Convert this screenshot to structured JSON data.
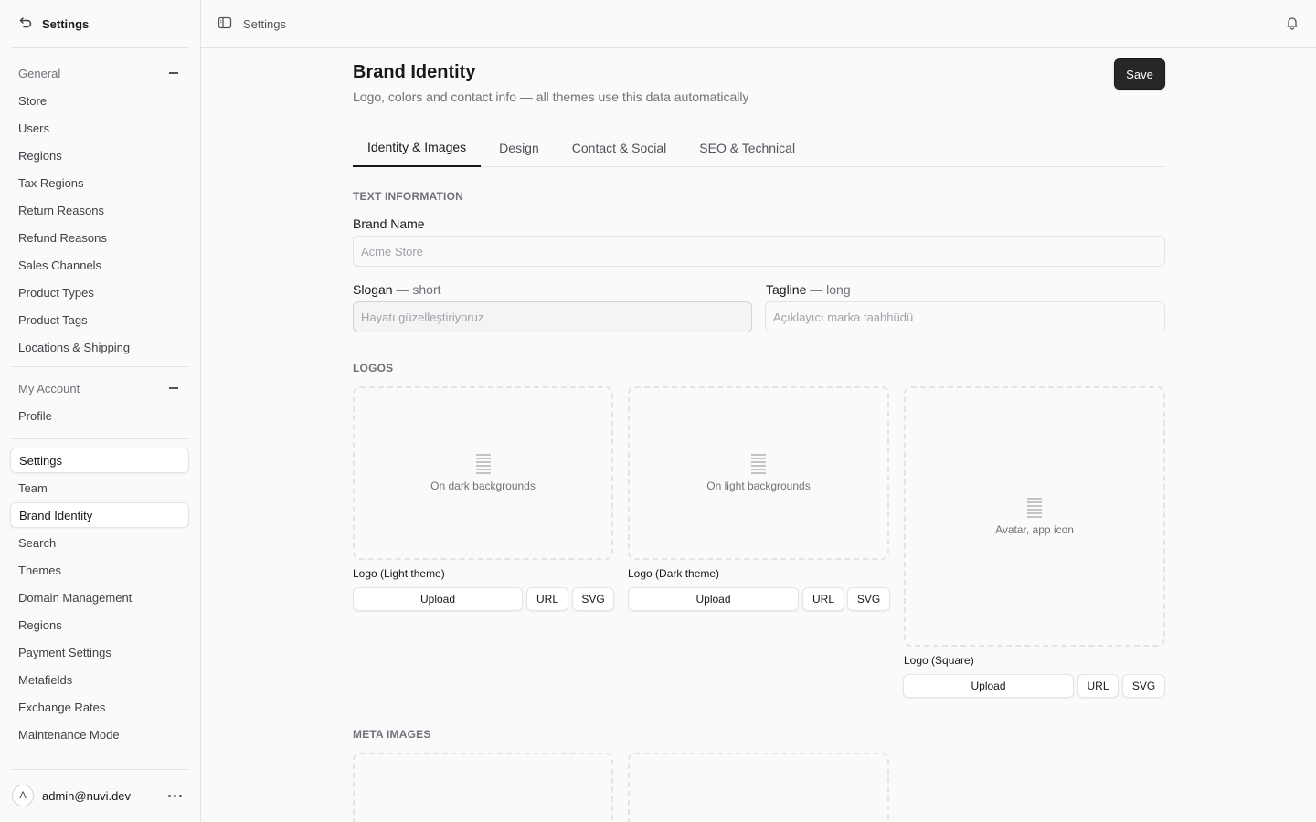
{
  "sidebar": {
    "back_title": "Settings",
    "general_label": "General",
    "general_items": [
      "Store",
      "Users",
      "Regions",
      "Tax Regions",
      "Return Reasons",
      "Refund Reasons",
      "Sales Channels",
      "Product Types",
      "Product Tags",
      "Locations & Shipping"
    ],
    "account_label": "My Account",
    "account_items": [
      "Profile"
    ],
    "extra_items": [
      "Settings",
      "Team",
      "Brand Identity",
      "Search",
      "Themes",
      "Domain Management",
      "Regions",
      "Payment Settings",
      "Metafields",
      "Exchange Rates",
      "Maintenance Mode"
    ],
    "user": {
      "initial": "A",
      "email": "admin@nuvi.dev"
    }
  },
  "topbar": {
    "breadcrumb": "Settings"
  },
  "page": {
    "title": "Brand Identity",
    "subtitle": "Logo, colors and contact info — all themes use this data automatically",
    "save_label": "Save",
    "tabs": [
      "Identity & Images",
      "Design",
      "Contact & Social",
      "SEO & Technical"
    ],
    "active_tab": "Identity & Images"
  },
  "text_info": {
    "section_label": "TEXT INFORMATION",
    "brand_name_label": "Brand Name",
    "brand_name_placeholder": "Acme Store",
    "slogan_label": "Slogan",
    "slogan_hint": "— short",
    "slogan_placeholder": "Hayatı güzelleştiriyoruz",
    "tagline_label": "Tagline",
    "tagline_hint": "— long",
    "tagline_placeholder": "Açıklayıcı marka taahhüdü"
  },
  "logos": {
    "section_label": "LOGOS",
    "items": [
      {
        "hint": "On dark backgrounds",
        "label": "Logo (Light theme)"
      },
      {
        "hint": "On light backgrounds",
        "label": "Logo (Dark theme)"
      },
      {
        "hint": "Avatar, app icon",
        "label": "Logo (Square)"
      }
    ],
    "upload_label": "Upload",
    "url_label": "URL",
    "svg_label": "SVG"
  },
  "meta_images": {
    "section_label": "META IMAGES"
  }
}
